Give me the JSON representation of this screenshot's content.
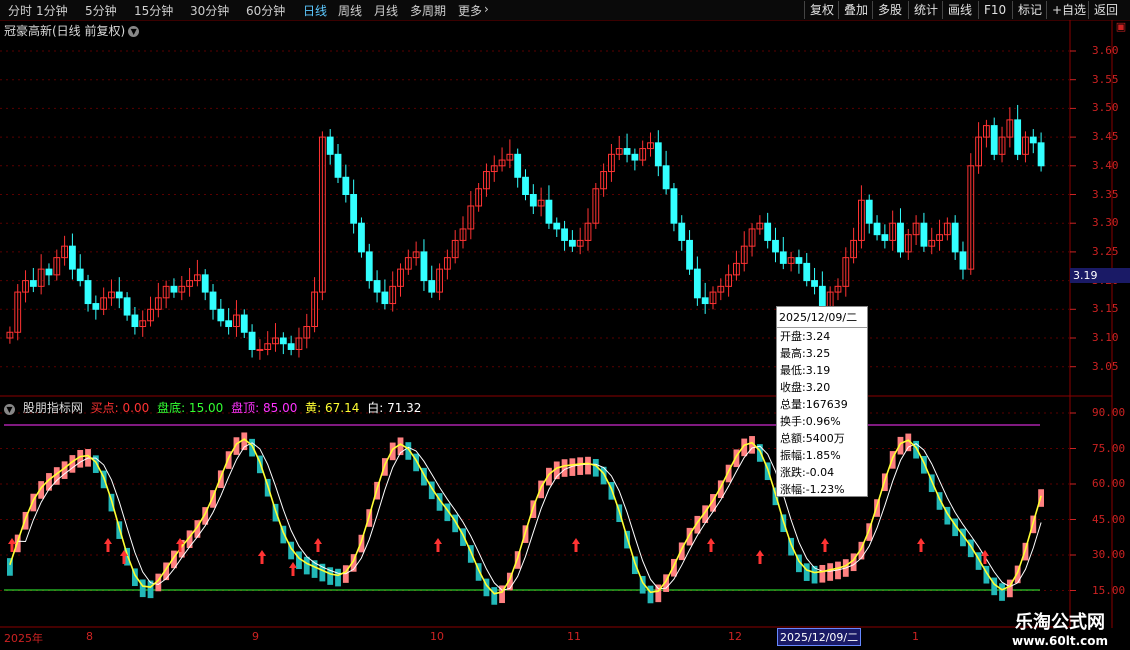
{
  "toolbar": {
    "periods": [
      "分时",
      "1分钟",
      "5分钟",
      "15分钟",
      "30分钟",
      "60分钟",
      "日线",
      "周线",
      "月线",
      "多周期",
      "更多"
    ],
    "active_period": "日线",
    "buttons": [
      "复权",
      "叠加",
      "多股",
      "统计",
      "画线",
      "F10",
      "标记",
      "+自选",
      "返回"
    ]
  },
  "main_panel": {
    "title": "冠豪高新(日线 前复权)",
    "y_labels": [
      "3.60",
      "3.55",
      "3.50",
      "3.45",
      "3.40",
      "3.35",
      "3.30",
      "3.25",
      "3.20",
      "3.15",
      "3.10",
      "3.05"
    ],
    "current_price": "3.19"
  },
  "indicator_panel": {
    "name": "股朋指标网",
    "buy_label": "买点: 0.00",
    "bottom_label": "盘底: 15.00",
    "top_label": "盘顶: 85.00",
    "yellow_label": "黄: 67.14",
    "white_label": "白: 71.32",
    "y_labels": [
      "90.00",
      "75.00",
      "60.00",
      "45.00",
      "30.00",
      "15.00"
    ]
  },
  "tooltip": {
    "date": "2025/12/09/二",
    "rows": [
      "开盘:3.24",
      "最高:3.25",
      "最低:3.19",
      "收盘:3.20",
      "总量:167639",
      "换手:0.96%",
      "总额:5400万",
      "振幅:1.85%",
      "涨跌:-0.04",
      "涨幅:-1.23%"
    ]
  },
  "x_axis": {
    "labels": [
      "2025年",
      "8",
      "9",
      "10",
      "11",
      "12",
      "2025/12/09/二",
      "1"
    ]
  },
  "watermark": {
    "line1": "乐淘公式网",
    "line2": "www.60lt.com"
  },
  "colors": {
    "up": "#ff3333",
    "down": "#33ffff",
    "bg": "#000000",
    "yellow": "#ffff33",
    "purple": "#ff33ff",
    "green": "#33ff33",
    "pink": "#ff8080",
    "teal": "#22b8b8"
  }
}
